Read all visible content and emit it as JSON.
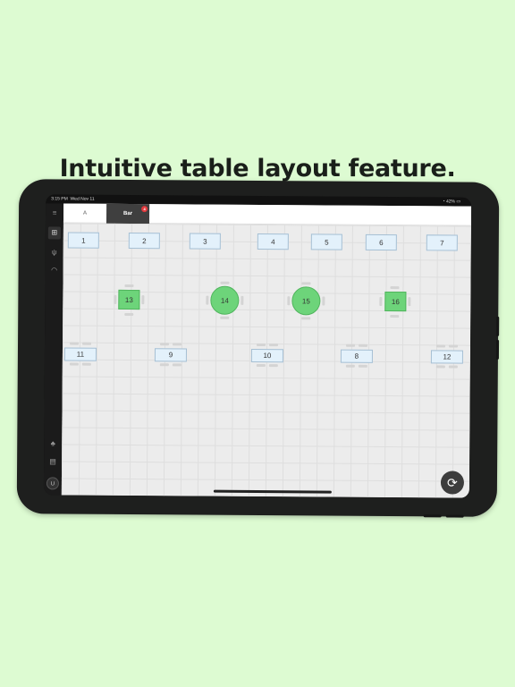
{
  "headline": "Intuitive table layout feature.",
  "status": {
    "time": "3:15 PM",
    "date": "Wed Nov 11",
    "battery": "42%"
  },
  "tabs": [
    {
      "label": "A",
      "active": false
    },
    {
      "label": "Bar",
      "active": true,
      "badge": "4"
    }
  ],
  "sidebar": {
    "icons": [
      "menu-icon",
      "table-layout-icon",
      "dining-icon",
      "wifi-icon"
    ],
    "bottom_icons": [
      "bell-icon",
      "printer-icon"
    ],
    "user_initial": "U"
  },
  "tables": {
    "row1": [
      "1",
      "2",
      "3",
      "4",
      "5",
      "6",
      "7"
    ],
    "row2": [
      "13",
      "14",
      "15",
      "16"
    ],
    "row3": [
      "11",
      "9",
      "10",
      "8",
      "12"
    ]
  },
  "colors": {
    "background": "#ddfbd2",
    "occupied": "#6dd47a",
    "free": "#e3f1fb",
    "badge": "#e0393d"
  }
}
